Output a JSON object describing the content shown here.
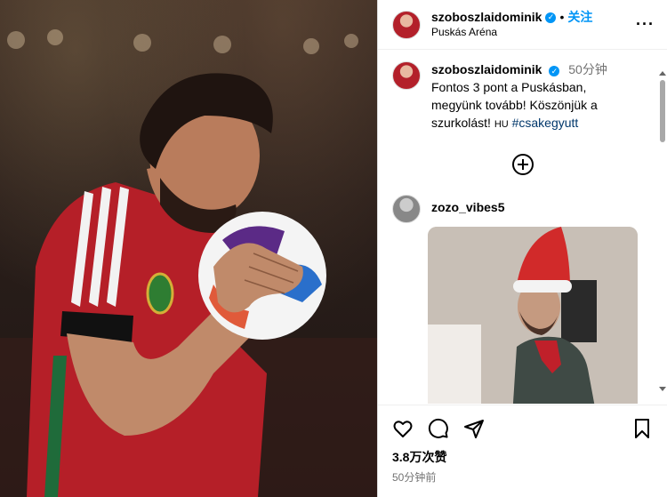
{
  "post": {
    "username": "szoboszlaidominik",
    "follow_label": "关注",
    "location": "Puskás Aréna",
    "more_label": "···"
  },
  "caption": {
    "username": "szoboszlaidominik",
    "time": "50分钟",
    "line1": "Fontos 3 pont a Puskásban,",
    "line2": "megyünk tovább! Köszönjük a",
    "line3_prefix": "szurkolást!",
    "flag": "HU",
    "hashtag": "#csakegyutt"
  },
  "comment": {
    "username": "zozo_vibes5"
  },
  "stats": {
    "likes": "3.8万次赞",
    "posted": "50分钟前"
  },
  "icons": [
    "verified-badge-icon",
    "more-options-icon",
    "add-comment-icon",
    "heart-icon",
    "comment-icon",
    "share-icon",
    "bookmark-icon"
  ],
  "colors": {
    "link": "#0095f6",
    "hashtag": "#00376b",
    "muted": "#737373",
    "jersey": "#c0202a"
  }
}
